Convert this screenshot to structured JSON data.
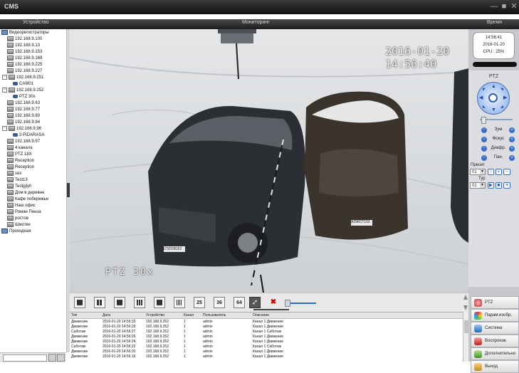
{
  "app": {
    "title": "CMS"
  },
  "window_buttons": {
    "minimize": "—",
    "restore": "■",
    "close": "✕"
  },
  "header": {
    "device": "Устройство",
    "monitoring": "Мониторинг",
    "time": "Время"
  },
  "tree": {
    "root": "Видеорегистраторы",
    "items": [
      "192.168.9.100",
      "192.168.9.13",
      "192.168.9.153",
      "192.168.9.169",
      "192.168.9.225",
      "192.168.9.227",
      "192.168.9.251",
      "CAM01",
      "192.168.9.252",
      "PTZ 30x",
      "192.168.9.63",
      "192.168.9.77",
      "192.168.9.80",
      "192.168.9.94",
      "192.168.9.96",
      "3 PIDARASA",
      "192.168.9.97",
      "4 канала",
      "PTZ 18X",
      "Reception",
      "Reception",
      "sex",
      "Test13",
      "Testjglyh",
      "Дом в деревне",
      "Кафе побережье",
      "Наш офис",
      "Роман Пенза",
      "ростов",
      "Шмотки"
    ],
    "second_root": "Проходная"
  },
  "video": {
    "osd_time": "2016-01-20 14:56:40",
    "osd_name": "PTZ 30x",
    "plate_left": "В732ОВ152",
    "plate_right": "А296СТ152"
  },
  "layout_buttons": [
    "",
    "",
    "",
    "",
    "",
    "",
    "25",
    "36",
    "64"
  ],
  "log": {
    "headers": [
      "Тип",
      "Дата",
      "Устройство",
      "Канал",
      "Пользователь",
      "Описание"
    ],
    "rows": [
      [
        "Движение",
        "2016-01-20 14:56:33",
        "192.168.9.252",
        "1",
        "admin",
        "Канал 1 Движение"
      ],
      [
        "Движение",
        "2016-01-20 14:56:29",
        "192.168.9.252",
        "1",
        "admin",
        "Канал 1 Движение"
      ],
      [
        "Саботаж",
        "2016-01-20 14:56:27",
        "192.168.9.252",
        "1",
        "admin",
        "Канал 1 Саботаж"
      ],
      [
        "Движение",
        "2016-01-20 14:56:26",
        "192.168.9.252",
        "1",
        "admin",
        "Канал 1 Движение"
      ],
      [
        "Движение",
        "2016-01-20 14:56:24",
        "192.168.9.252",
        "1",
        "admin",
        "Канал 1 Движение"
      ],
      [
        "Саботаж",
        "2016-01-20 14:56:22",
        "192.168.9.252",
        "1",
        "admin",
        "Канал 1 Саботаж"
      ],
      [
        "Движение",
        "2016-01-20 14:56:20",
        "192.168.9.252",
        "1",
        "admin",
        "Канал 1 Движение"
      ],
      [
        "Движение",
        "2016-01-20 14:56:15",
        "192.168.9.252",
        "1",
        "admin",
        "Канал 1 Движение"
      ]
    ]
  },
  "clock": {
    "time": "14:56:41",
    "date": "2016-01-20",
    "cpu": "CPU : 25%"
  },
  "ptz": {
    "title": "PTZ",
    "zoom": "Зум",
    "focus": "Фокус",
    "iris": "Диафр.",
    "pan": "Пан.",
    "preset_label": "Пресет",
    "preset_value": "01",
    "tour_label": "Тур",
    "tour_value": "01"
  },
  "menu": {
    "ptz": "PTZ",
    "image_params": "Парам.изобр.",
    "system": "Система",
    "playback": "Воспроизв.",
    "extra": "Дополнительно",
    "exit": "Выход"
  },
  "colors": {
    "accent": "#3b6fc5",
    "titlebar": "#111111",
    "panel": "#c6c8cc"
  }
}
